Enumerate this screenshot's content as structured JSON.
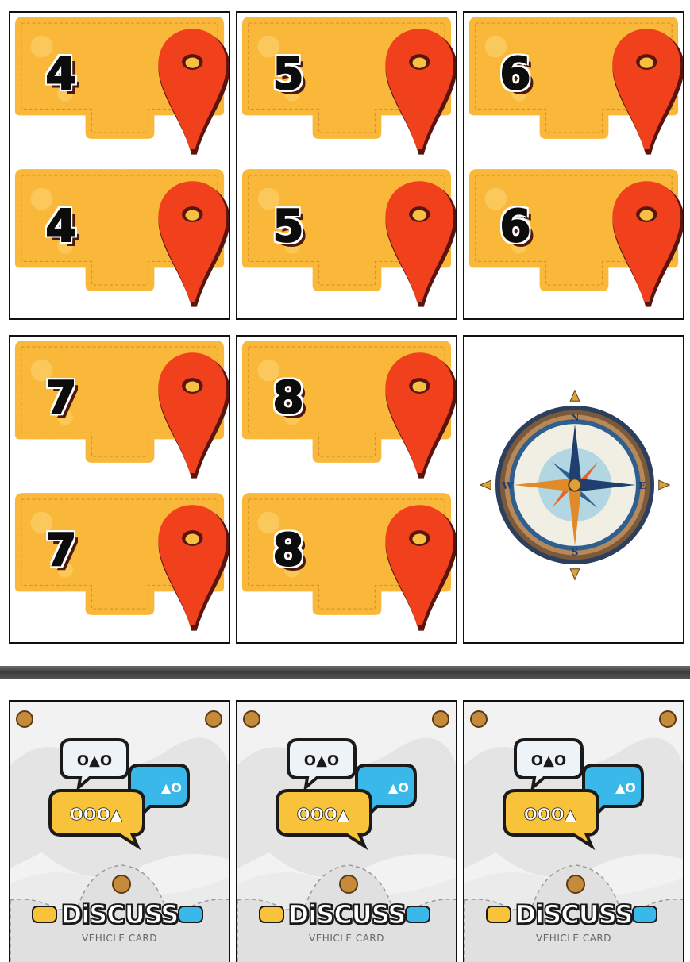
{
  "colors": {
    "tab_orange": "#f9b83a",
    "tab_orange_light": "#fcd06a",
    "pin_red": "#f0401c",
    "pin_dark": "#5a1510",
    "bubble_yellow": "#f8c23a",
    "bubble_blue": "#3bb8ea",
    "bubble_white": "#eef3f8",
    "compass_blue": "#2f5f8e",
    "compass_gold": "#d9a23c"
  },
  "location_cards": [
    {
      "top": "4",
      "bottom": "4"
    },
    {
      "top": "5",
      "bottom": "5"
    },
    {
      "top": "6",
      "bottom": "6"
    },
    {
      "top": "7",
      "bottom": "7"
    },
    {
      "top": "8",
      "bottom": "8"
    }
  ],
  "compass_card": {
    "letters": {
      "n": "N",
      "e": "E",
      "s": "S",
      "w": "W"
    }
  },
  "discuss_cards": [
    {
      "title": "DiSCUSS",
      "subtitle": "VEHICLE CARD"
    },
    {
      "title": "DiSCUSS",
      "subtitle": "VEHICLE CARD"
    },
    {
      "title": "DiSCUSS",
      "subtitle": "VEHICLE CARD"
    }
  ]
}
